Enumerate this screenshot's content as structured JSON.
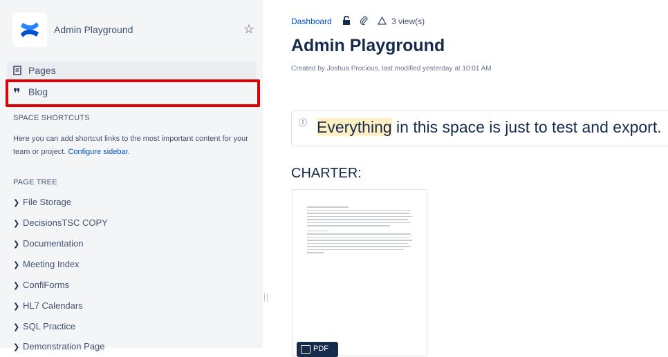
{
  "sidebar": {
    "space_name": "Admin Playground",
    "nav": {
      "pages_label": "Pages",
      "blog_label": "Blog"
    },
    "shortcuts": {
      "title": "SPACE SHORTCUTS",
      "description": "Here you can add shortcut links to the most important content for your team or project.",
      "link_label": "Configure sidebar",
      "period": "."
    },
    "page_tree": {
      "title": "PAGE TREE",
      "items": [
        "File Storage",
        "DecisionsTSC COPY",
        "Documentation",
        "Meeting Index",
        "ConfiForms",
        "HL7 Calendars",
        "SQL Practice",
        "Demonstration Page"
      ]
    }
  },
  "main": {
    "breadcrumb": "Dashboard",
    "views": "3 view(s)",
    "title": "Admin Playground",
    "byline": "Created by Joshua Procious, last modified yesterday at 10:01 AM",
    "info_panel": {
      "highlight": "Everything",
      "text": " in this space is just to test and export."
    },
    "charter_heading": "CHARTER:",
    "attachment_badge": "PDF"
  },
  "colors": {
    "sidebar_bg": "#f4f5f7",
    "link": "#0052cc",
    "highlight_box": "#e00000",
    "logo_blue": "#0052cc",
    "text_mark": "#fff0c4"
  }
}
